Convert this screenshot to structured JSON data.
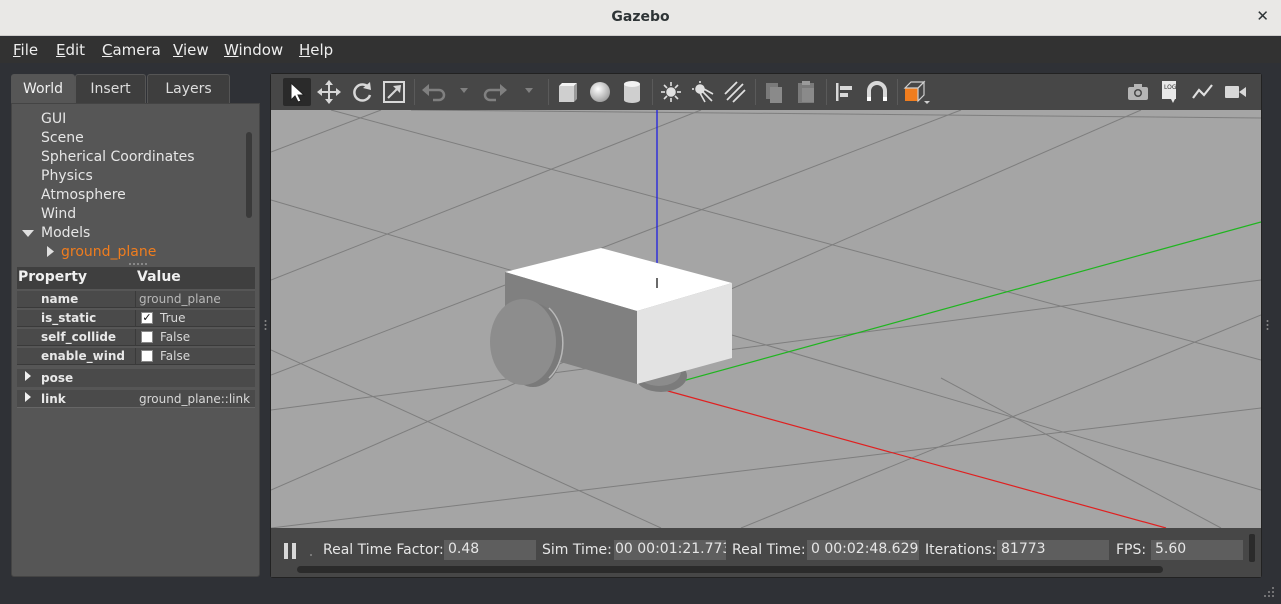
{
  "window": {
    "title": "Gazebo",
    "close_glyph": "✕"
  },
  "menu": [
    {
      "u": "F",
      "rest": "ile"
    },
    {
      "u": "E",
      "rest": "dit"
    },
    {
      "u": "C",
      "rest": "amera"
    },
    {
      "u": "V",
      "rest": "iew"
    },
    {
      "u": "W",
      "rest": "indow"
    },
    {
      "u": "H",
      "rest": "elp"
    }
  ],
  "tabs": [
    "World",
    "Insert",
    "Layers"
  ],
  "tree": {
    "items": [
      "GUI",
      "Scene",
      "Spherical Coordinates",
      "Physics",
      "Atmosphere",
      "Wind",
      "Models"
    ],
    "selected": "ground_plane"
  },
  "properties": {
    "header_property": "Property",
    "header_value": "Value",
    "rows": [
      {
        "key": "name",
        "value": "ground_plane"
      },
      {
        "key": "is_static",
        "check": "✓",
        "checked": true,
        "value": "True"
      },
      {
        "key": "self_collide",
        "check": "",
        "checked": false,
        "value": "False"
      },
      {
        "key": "enable_wind",
        "check": "",
        "checked": false,
        "value": "False"
      }
    ],
    "groups": [
      {
        "key": "pose",
        "value": ""
      },
      {
        "key": "link",
        "value": "ground_plane::link"
      }
    ]
  },
  "toolbar_icons": [
    "select-arrow-icon",
    "translate-icon",
    "rotate-icon",
    "scale-icon",
    "undo-icon",
    "redo-icon",
    "box-icon",
    "sphere-icon",
    "cylinder-icon",
    "point-light-icon",
    "spot-light-icon",
    "directional-light-icon",
    "copy-icon",
    "paste-icon",
    "align-icon",
    "snap-magnet-icon",
    "view-angle-icon",
    "screenshot-icon",
    "log-icon",
    "plot-icon",
    "record-video-icon"
  ],
  "status": {
    "rtf_label": "Real Time Factor:",
    "rtf_value": "0.48",
    "sim_label": "Sim Time:",
    "sim_value": "00 00:01:21.773",
    "real_label": "Real Time:",
    "real_value": "0 00:02:48.629",
    "iter_label": "Iterations:",
    "iter_value": "81773",
    "fps_label": "FPS:",
    "fps_value": "5.60"
  },
  "colors": {
    "accent": "#f07d1e",
    "axis_x": "#e02020",
    "axis_y": "#20c020",
    "axis_z": "#2020e0"
  }
}
